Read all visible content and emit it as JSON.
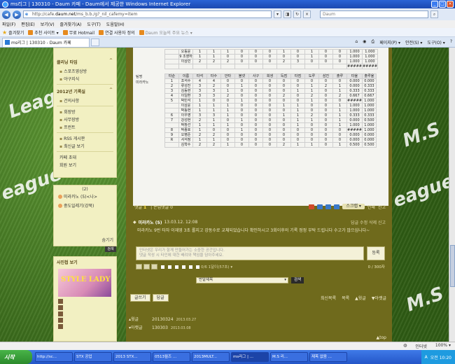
{
  "window": {
    "title": "ms리그 | 130310 - Daum 카페 - Daum에서 제공한 Windows Internet Explorer"
  },
  "address": {
    "url_prefix": "http://cafe.",
    "url_domain": "daum.net",
    "url_rest": "/ms_b.b./g?_nil_cafemy=item",
    "search_placeholder": "Daum"
  },
  "menu": [
    "파일(F)",
    "편집(E)",
    "보기(V)",
    "즐겨찾기(A)",
    "도구(T)",
    "도움말(H)"
  ],
  "favorites": {
    "label": "즐겨찾기",
    "items": [
      "추천 사이트 ▾",
      "무료 Hotmail",
      "연결 사용자 정의",
      "Daum 오늘의 주요 뉴스 ▾"
    ]
  },
  "tab": {
    "label": "ms리그 | 130310 - Daum 카페"
  },
  "commands": [
    "페이지(P) ▾",
    "안전(S) ▾",
    "도구(O) ▾"
  ],
  "sidebar": {
    "sections": [
      {
        "title": "클리닝 타임",
        "items": [
          "스포츠영상방",
          "야구지식"
        ]
      },
      {
        "title": "2012년 기록실",
        "items": [
          "건의사항"
        ]
      },
      {
        "title": "",
        "items": [
          "회장방",
          "사무장방",
          "프런트"
        ]
      },
      {
        "title": "",
        "items": [
          "RSS 게시판",
          "최신글 보기"
        ]
      }
    ],
    "links": [
      "카페 초대",
      "회원 보기"
    ]
  },
  "online": {
    "count": "(2)",
    "users": [
      "미라카노 (5)<나>",
      "중도일레기(강북)"
    ],
    "more": "숨기기"
  },
  "search_button": "검색",
  "photo": {
    "title": "사진첩 보기",
    "img_text": "STYLE LADY",
    "items": [
      "",
      "",
      "",
      "",
      ""
    ]
  },
  "stats": {
    "team1_rows": [
      [
        "",
        "오동윤",
        "1",
        "1",
        "1",
        "0",
        "0",
        "0",
        "1",
        "0",
        "1",
        "0",
        "0",
        "1.000",
        "1.000"
      ],
      [
        "",
        "9 조영하",
        "1",
        "1",
        "0",
        "0",
        "0",
        "0",
        "0",
        "0",
        "1",
        "0",
        "0",
        "1.000",
        "1.000"
      ],
      [
        "",
        "이상민",
        "2",
        "2",
        "2",
        "0",
        "0",
        "0",
        "2",
        "3",
        "0",
        "0",
        "0",
        "1.000",
        "1.000"
      ],
      [
        "",
        "",
        "",
        "",
        "",
        "",
        "",
        "",
        "",
        "",
        "",
        "",
        "",
        "#####",
        "#####"
      ]
    ],
    "team2_label": "팀명",
    "team2_name": "미라카노",
    "headers": [
      "타순",
      "이름",
      "타석",
      "타수",
      "안타",
      "볼넷",
      "사구",
      "희생",
      "득점",
      "타점",
      "도루",
      "삼진",
      "출루",
      "타율",
      "출루율"
    ],
    "team2_rows": [
      [
        "1",
        "조석수",
        "4",
        "4",
        "0",
        "0",
        "0",
        "0",
        "0",
        "0",
        "0",
        "0",
        "0",
        "0.000",
        "0.000"
      ],
      [
        "2",
        "류성진",
        "3",
        "2",
        "0",
        "1",
        "0",
        "0",
        "0",
        "0",
        "1",
        "2",
        "1",
        "0.000",
        "0.333"
      ],
      [
        "3",
        "김동현",
        "3",
        "3",
        "1",
        "0",
        "0",
        "0",
        "0",
        "1",
        "1",
        "0",
        "1",
        "0.333",
        "0.333"
      ],
      [
        "4",
        "이일환",
        "3",
        "3",
        "2",
        "0",
        "0",
        "0",
        "2",
        "0",
        "2",
        "0",
        "2",
        "0.667",
        "0.667"
      ],
      [
        "5",
        "박민석",
        "1",
        "0",
        "0",
        "1",
        "0",
        "0",
        "0",
        "0",
        "1",
        "0",
        "0",
        "#####",
        "1.000"
      ],
      [
        "",
        "이상윤",
        "1",
        "1",
        "1",
        "0",
        "0",
        "0",
        "1",
        "1",
        "0",
        "0",
        "1",
        "1.000",
        "1.000"
      ],
      [
        "",
        "박동현",
        "1",
        "1",
        "1",
        "0",
        "0",
        "0",
        "0",
        "1",
        "0",
        "0",
        "1",
        "1.000",
        "1.000"
      ],
      [
        "6",
        "이우영",
        "3",
        "3",
        "1",
        "0",
        "0",
        "0",
        "1",
        "1",
        "2",
        "0",
        "1",
        "0.333",
        "0.333"
      ],
      [
        "7",
        "강성현",
        "2",
        "1",
        "0",
        "1",
        "0",
        "0",
        "0",
        "1",
        "1",
        "0",
        "1",
        "0.000",
        "0.500"
      ],
      [
        "",
        "박창선",
        "1",
        "1",
        "1",
        "0",
        "0",
        "0",
        "0",
        "1",
        "0",
        "0",
        "1",
        "1.000",
        "1.000"
      ],
      [
        "8",
        "박종호",
        "1",
        "0",
        "0",
        "1",
        "0",
        "0",
        "0",
        "0",
        "0",
        "0",
        "0",
        "#####",
        "1.000"
      ],
      [
        "9",
        "오병준",
        "2",
        "2",
        "0",
        "0",
        "0",
        "0",
        "0",
        "0",
        "0",
        "0",
        "0",
        "0.000",
        "0.000"
      ],
      [
        "R",
        "서석정",
        "1",
        "1",
        "0",
        "0",
        "0",
        "0",
        "0",
        "0",
        "0",
        "0",
        "0",
        "0.000",
        "0.000"
      ],
      [
        "",
        "김학수",
        "2",
        "2",
        "1",
        "0",
        "0",
        "0",
        "2",
        "1",
        "1",
        "0",
        "1",
        "0.500",
        "0.500"
      ]
    ]
  },
  "comments": {
    "label": "댓글",
    "count": "1",
    "secret": "| 손님댓글 0",
    "scrap": "스크랩 ▾",
    "print": "인쇄",
    "report": "신고",
    "author": "미라카노 (5)",
    "time": "13.03.12. 12:08",
    "actions": "답글  수정  삭제  신고",
    "body": "미라카노 9번 타자 이재영 3초 롤지고 강동수로 교체되었습니다 확인하시고 3회이후의 기록 정정 부탁 드립니다 수고가 많으십니다~",
    "placeholder_1": "인터넷은 우리가 함께 만들어가는 소중한 공간입니다.",
    "placeholder_2": "댓글 작성 시 타인에 대한 배려와 책임을 담아주세요.",
    "submit": "등록",
    "tools_text": "0/6 1달이(57초) ▾",
    "limit": "0 / 300자"
  },
  "select": {
    "value": "반말제목",
    "button": "검색"
  },
  "buttons": {
    "write": "글쓰기",
    "reply": "답글",
    "list": "최신목록",
    "catlist": "목록",
    "prev": "▲윗글",
    "next": "▼아랫글"
  },
  "prevnext": {
    "prev_label": "윗글",
    "prev_title": "20130324",
    "prev_date": "2013.03.27",
    "next_label": "아랫글",
    "next_title": "130303",
    "next_date": "2013.03.08"
  },
  "top_link": "▲top",
  "status": {
    "left": "",
    "zone": "인터넷",
    "zoom": "100% ▾"
  },
  "taskbar": {
    "start": "시작",
    "tasks": [
      "http://sc...",
      "STX 공업",
      "2013 STX...",
      "0513월즈 ...",
      "2013MULT...",
      "ms리그 | ...",
      "M.S 리...",
      "제목 없음 ..."
    ],
    "clock": "오전 10:20"
  }
}
